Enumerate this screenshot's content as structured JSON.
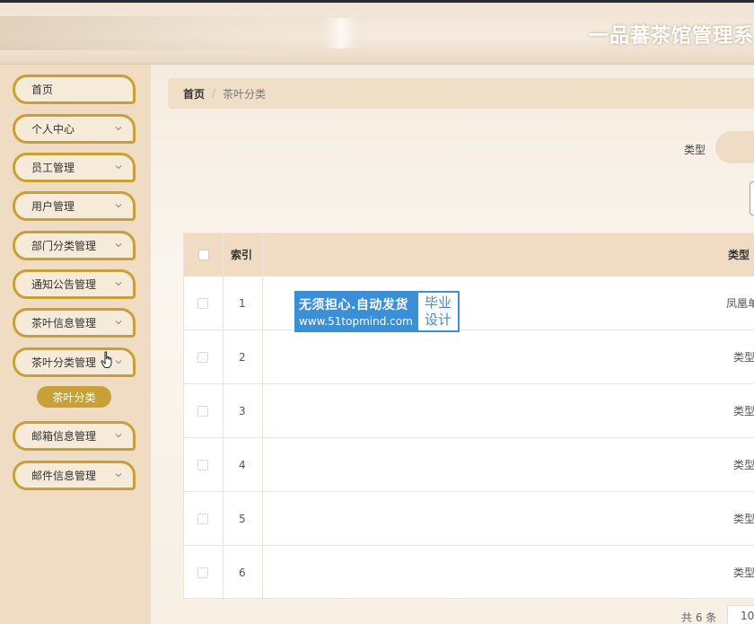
{
  "header": {
    "title": "一品蕃茶馆管理系"
  },
  "sidebar": {
    "items": [
      {
        "label": "首页",
        "has_chevron": false
      },
      {
        "label": "个人中心",
        "has_chevron": true
      },
      {
        "label": "员工管理",
        "has_chevron": true
      },
      {
        "label": "用户管理",
        "has_chevron": true
      },
      {
        "label": "部门分类管理",
        "has_chevron": true
      },
      {
        "label": "通知公告管理",
        "has_chevron": true
      },
      {
        "label": "茶叶信息管理",
        "has_chevron": true
      },
      {
        "label": "茶叶分类管理",
        "has_chevron": true,
        "expanded": true
      },
      {
        "label": "邮箱信息管理",
        "has_chevron": true
      },
      {
        "label": "邮件信息管理",
        "has_chevron": true
      }
    ],
    "active_sub_item": "茶叶分类"
  },
  "breadcrumb": {
    "home": "首页",
    "separator": "/",
    "current": "茶叶分类"
  },
  "search": {
    "label": "类型",
    "value": ""
  },
  "table": {
    "headers": {
      "index": "索引",
      "type": "类型"
    },
    "rows": [
      {
        "index": "1",
        "type": "凤凰单"
      },
      {
        "index": "2",
        "type": "类型"
      },
      {
        "index": "3",
        "type": "类型"
      },
      {
        "index": "4",
        "type": "类型"
      },
      {
        "index": "5",
        "type": "类型"
      },
      {
        "index": "6",
        "type": "类型"
      }
    ]
  },
  "pagination": {
    "total_text": "共 6 条",
    "page_size": "10"
  },
  "watermark": {
    "line1": "无须担心.自动发货",
    "line2": "www.51topmind.com",
    "badge_line1": "毕业",
    "badge_line2": "设计"
  },
  "colors": {
    "accent": "#c9a037",
    "sidebar_bg": "#efdcc2",
    "table_header_bg": "#efdcc2",
    "watermark_blue": "#3a8fd6"
  }
}
